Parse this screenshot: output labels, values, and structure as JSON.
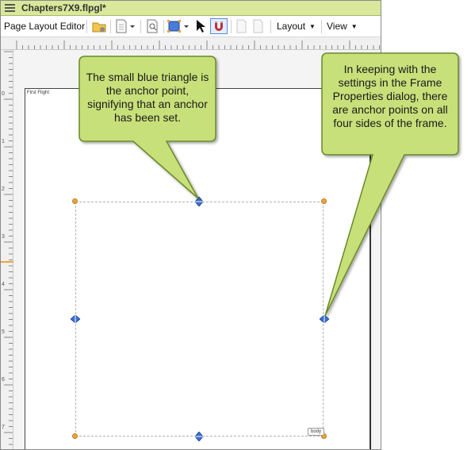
{
  "window": {
    "title": "Chapters7X9.flpgl*"
  },
  "toolbar": {
    "editor_label": "Page Layout Editor",
    "layout_label": "Layout",
    "view_label": "View"
  },
  "page": {
    "name_label": "First Flight"
  },
  "frame": {
    "tag": "body"
  },
  "rulers": {
    "vertical_marks": [
      "0",
      "1",
      "2",
      "3",
      "4",
      "5",
      "6",
      "7"
    ]
  },
  "callouts": {
    "anchor_callout": "The small blue triangle is the anchor point, signifying that an anchor has been set.",
    "frame_callout": "In keeping with the settings in the Frame Properties dialog, there are anchor points on all four sides of the frame."
  },
  "colors": {
    "titlebar": "#d9e89a",
    "callout_fill": "#c8e07a",
    "callout_border": "#6a8a2a",
    "handle": "#f0a23c",
    "anchor": "#3b6fd6"
  }
}
